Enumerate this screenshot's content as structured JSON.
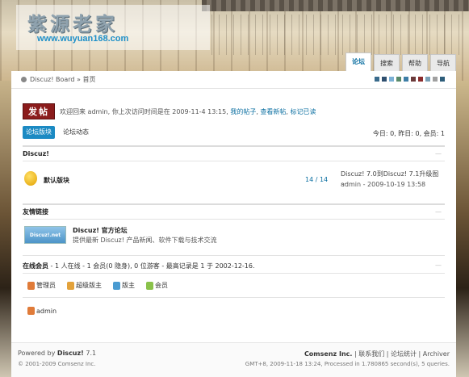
{
  "header": {
    "logo_title": "紫源老家",
    "logo_url": "www.wuyuan168.com"
  },
  "topnav": {
    "tabs": [
      {
        "label": "论坛",
        "active": true
      },
      {
        "label": "搜索",
        "active": false
      },
      {
        "label": "帮助",
        "active": false
      },
      {
        "label": "导航",
        "active": false
      }
    ]
  },
  "breadcrumb": {
    "text": "Discuz! Board » 首页"
  },
  "style_swatches": [
    "#3a6b8c",
    "#2f4f6f",
    "#7bb0d4",
    "#5a8a6a",
    "#3e7ea6",
    "#6b3a3a",
    "#8b2c2c",
    "#7a9fb5",
    "#a0a0a0",
    "#2e5d7a"
  ],
  "welcome": {
    "post_button": "发帖",
    "text": "欢迎回来 admin, 你上次访问时间是在 2009-11-4 13:15, ",
    "links": [
      "我的帖子",
      "查看新帖",
      "标记已读"
    ],
    "separator": ", "
  },
  "subtabs": [
    {
      "label": "论坛版块",
      "active": true
    },
    {
      "label": "论坛动态",
      "active": false
    }
  ],
  "stats": "今日: 0, 昨日: 0, 会员: 1",
  "forum_section": {
    "title": "Discuz!",
    "collapse": "—",
    "forum": {
      "name": "默认版块",
      "count": "14 / 14",
      "last_post_title": "Discuz! 7.0到Discuz! 7.1升级图 ...",
      "last_post_meta": "admin - 2009-10-19 13:58"
    }
  },
  "links_section": {
    "title": "友情链接",
    "collapse": "—",
    "link": {
      "logo_text": "Discuz!.net",
      "name": "Discuz! 官方论坛",
      "desc": "提供最新 Discuz! 产品新闻、软件下载与技术交流"
    }
  },
  "online_section": {
    "title": "在线会员",
    "summary": " - 1 人在线 - 1 会员(0 隐身), 0 位游客 - 最高记录是 1 于 2002-12-16.",
    "collapse": "—",
    "legend": [
      {
        "label": "管理员",
        "color": "#e07b39"
      },
      {
        "label": "超级版主",
        "color": "#e3a23b"
      },
      {
        "label": "版主",
        "color": "#4a9bd1"
      },
      {
        "label": "会员",
        "color": "#8ac24a"
      }
    ],
    "users": [
      {
        "name": "admin",
        "color": "#e07b39"
      }
    ]
  },
  "footer": {
    "powered_prefix": "Powered by ",
    "powered_brand": "Discuz!",
    "powered_version": " 7.1",
    "copyright": "© 2001-2009 Comsenz Inc.",
    "company": "Comsenz Inc.",
    "links": " | 联系我们 | 论坛统计 | Archiver",
    "gmt": "GMT+8, 2009-11-18 13:24, Processed in 1.780865 second(s), 5 queries."
  }
}
